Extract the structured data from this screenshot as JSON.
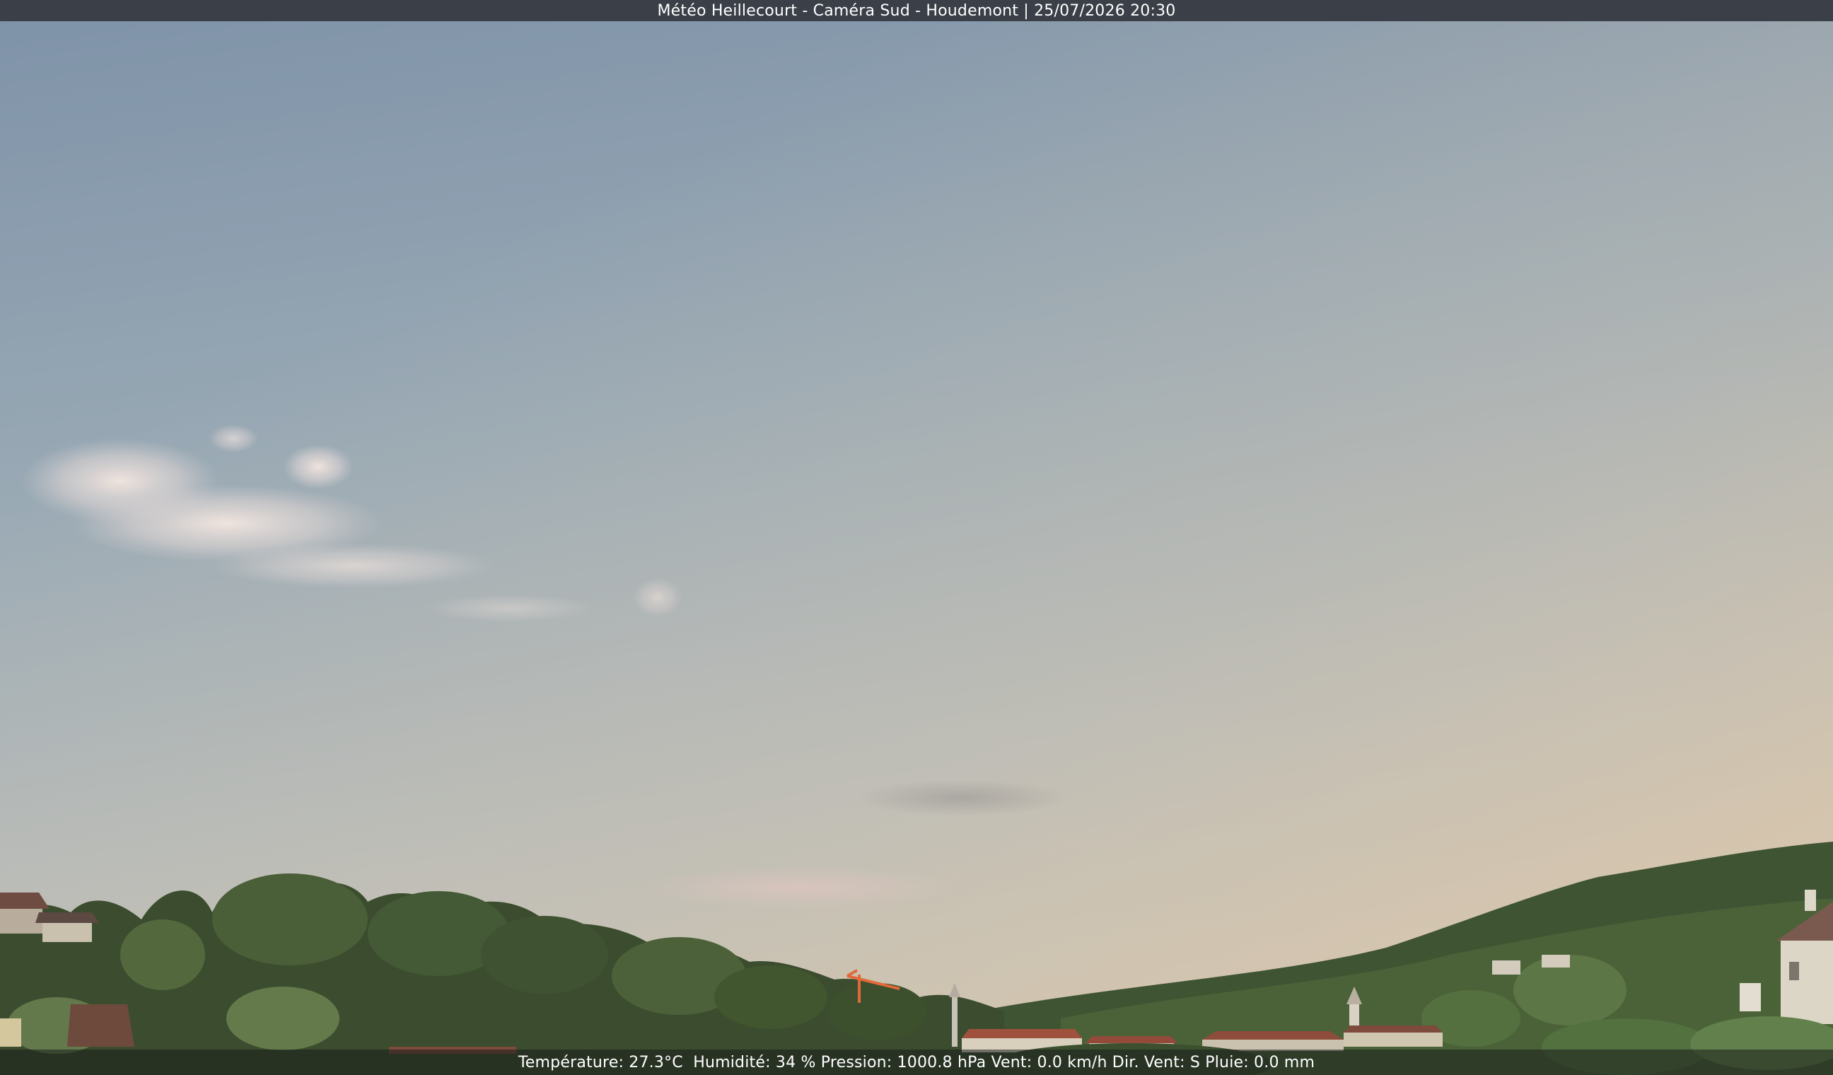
{
  "caption": {
    "title": "Météo Heillecourt - Caméra Sud - Houdemont | 25/07/2026 20:30"
  },
  "weather": {
    "readout": "Température: 27.3°C  Humidité: 34 % Pression: 1000.8 hPa Vent: 0.0 km/h Dir. Vent: S Pluie: 0.0 mm"
  },
  "colors": {
    "sky_top": "#7f93a8",
    "sky_mid": "#a9b7bf",
    "sky_horizon": "#d2c6b4",
    "foliage_dark": "#2f3f28",
    "foliage_mid": "#4a5e38",
    "foliage_light": "#6f8653",
    "roof": "#8a4a3a",
    "wall": "#d8d0bc",
    "bar": "#3a3f48"
  }
}
